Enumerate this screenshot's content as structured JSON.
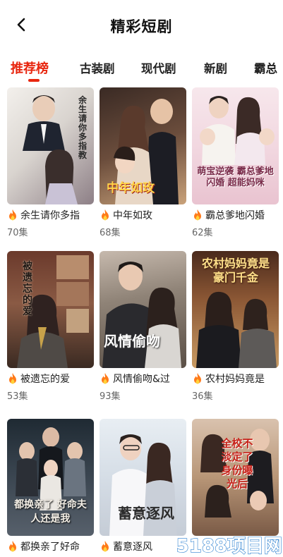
{
  "header": {
    "title": "精彩短剧"
  },
  "tabs": [
    "推荐榜",
    "古装剧",
    "现代剧",
    "新剧",
    "霸总"
  ],
  "cards": [
    {
      "title": "余生请你多指",
      "count": "70集",
      "poster_text": "余生请你多指教"
    },
    {
      "title": "中年如玫",
      "count": "68集",
      "poster_text": "中年如玫"
    },
    {
      "title": "霸总爹地闪婚",
      "count": "62集",
      "poster_text": "萌宝逆袭 霸总爹地闪婚 超能妈咪"
    },
    {
      "title": "被遗忘的爱",
      "count": "53集",
      "poster_text": "被遗忘的爱"
    },
    {
      "title": "风情偷吻&过",
      "count": "93集",
      "poster_text": "风情偷吻"
    },
    {
      "title": "农村妈妈竟是",
      "count": "36集",
      "poster_text": "农村妈妈竟是豪门千金"
    },
    {
      "title": "都换亲了好命",
      "count": "",
      "poster_text": "都换亲了 好命夫人还是我"
    },
    {
      "title": "蓄意逐风",
      "count": "",
      "poster_text": "蓄意逐风"
    },
    {
      "title": "",
      "count": "",
      "poster_text": "全校不淡定了 身份曝光后"
    }
  ],
  "watermark": {
    "text": "5188项目网"
  },
  "colors": {
    "accent": "#e8260f",
    "flame": "#ff7a1a"
  }
}
